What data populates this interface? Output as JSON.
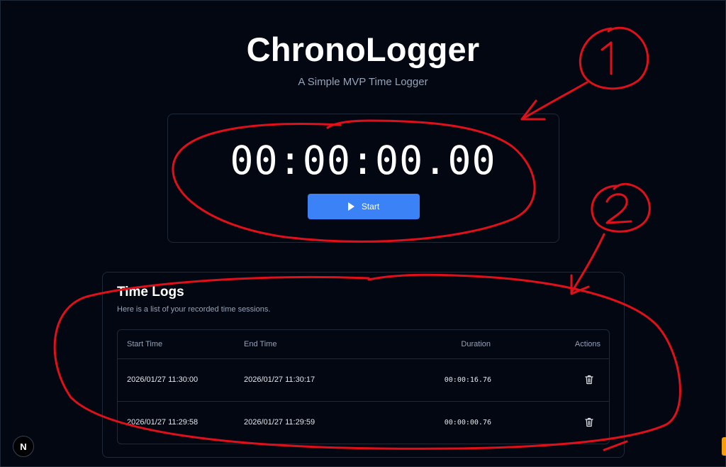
{
  "app": {
    "title": "ChronoLogger",
    "subtitle": "A Simple MVP Time Logger"
  },
  "timer": {
    "display": "00:00:00.00",
    "start_label": "Start",
    "start_icon": "play-icon"
  },
  "logs": {
    "title": "Time Logs",
    "subtitle": "Here is a list of your recorded time sessions.",
    "columns": [
      "Start Time",
      "End Time",
      "Duration",
      "Actions"
    ],
    "rows": [
      {
        "start": "2026/01/27 11:30:00",
        "end": "2026/01/27 11:30:17",
        "duration": "00:00:16.76",
        "action_icon": "trash-icon"
      },
      {
        "start": "2026/01/27 11:29:58",
        "end": "2026/01/27 11:29:59",
        "duration": "00:00:00.76",
        "action_icon": "trash-icon"
      }
    ]
  },
  "annotations": {
    "label_1": "1",
    "label_2": "2",
    "color": "#e0101a"
  },
  "badge": {
    "label": "N"
  },
  "colors": {
    "background": "#030712",
    "accent": "#3b82f6",
    "border": "#1f2937",
    "muted_text": "#94a3b8"
  }
}
